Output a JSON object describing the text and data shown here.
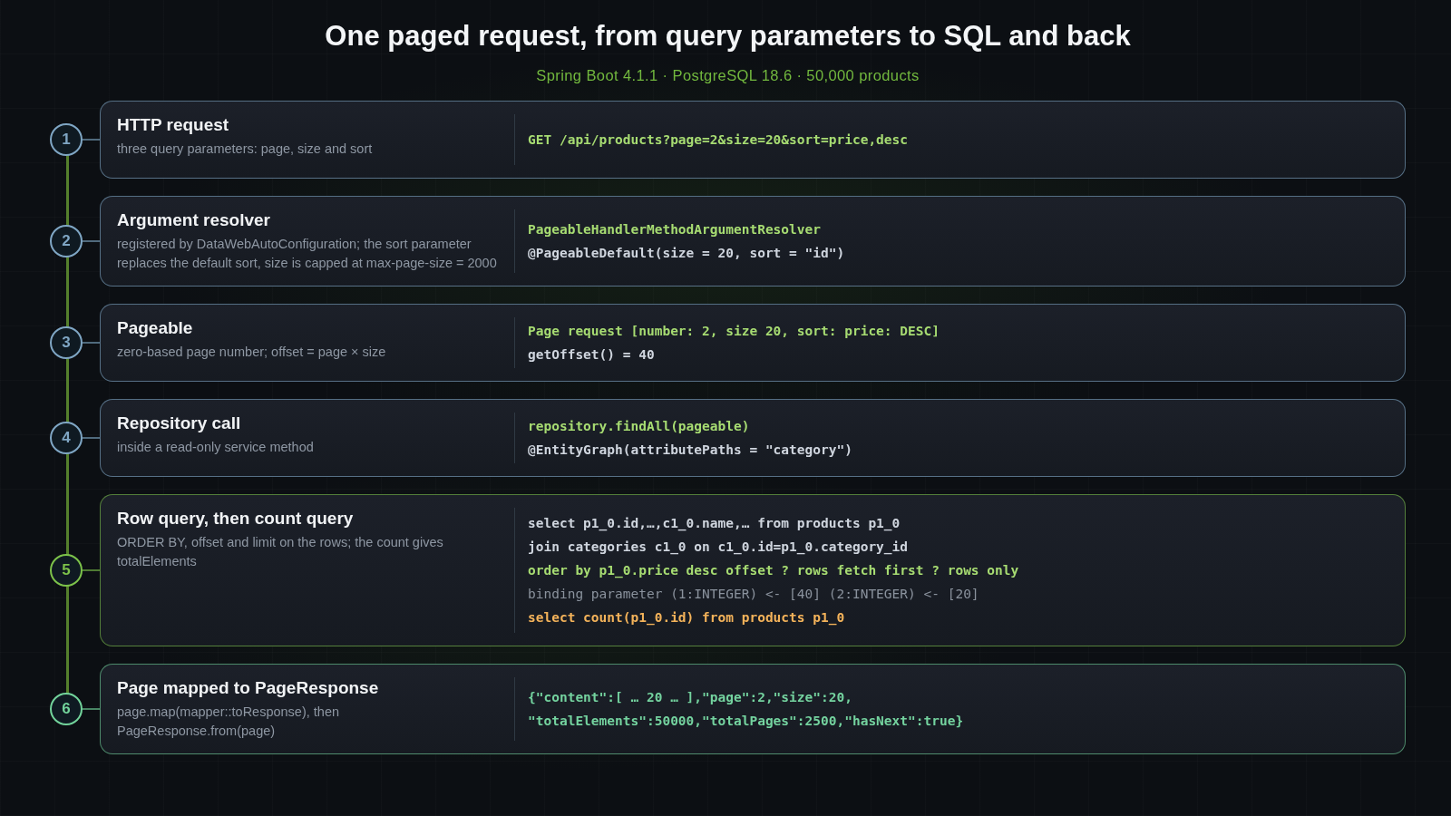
{
  "title": "One paged request, from query parameters to SQL and back",
  "subtitle": "Spring Boot 4.1.1 · PostgreSQL 18.6 · 50,000 products",
  "steps": [
    {
      "number": "1",
      "color": "#7fa6c4",
      "title": "HTTP request",
      "description": "three query parameters: page, size and sort",
      "code": [
        {
          "kind": "key",
          "text": "GET /api/products?page=2&size=20&sort=price,desc"
        }
      ]
    },
    {
      "number": "2",
      "color": "#7fa6c4",
      "title": "Argument resolver",
      "description": "registered by DataWebAutoConfiguration; the sort parameter replaces the default sort, size is capped at max-page-size = 2000",
      "code": [
        {
          "kind": "key",
          "text": "PageableHandlerMethodArgumentResolver"
        },
        {
          "kind": "plain",
          "text": "@PageableDefault(size = 20, sort = \"id\")"
        }
      ]
    },
    {
      "number": "3",
      "color": "#7fa6c4",
      "title": "Pageable",
      "description": "zero-based page number; offset = page × size",
      "code": [
        {
          "kind": "key",
          "text": "Page request [number: 2, size 20, sort: price: DESC]"
        },
        {
          "kind": "plain",
          "text": "getOffset() = 40"
        }
      ]
    },
    {
      "number": "4",
      "color": "#7fa6c4",
      "title": "Repository call",
      "description": "inside a read-only service method",
      "code": [
        {
          "kind": "key",
          "text": "repository.findAll(pageable)"
        },
        {
          "kind": "plain",
          "text": "@EntityGraph(attributePaths = \"category\")"
        }
      ]
    },
    {
      "number": "5",
      "color": "#7cc24a",
      "title": "Row query, then count query",
      "description": "ORDER BY, offset and limit on the rows; the count gives totalElements",
      "code": [
        {
          "kind": "plain",
          "text": "select p1_0.id,…,c1_0.name,… from products p1_0"
        },
        {
          "kind": "plain",
          "text": "join categories c1_0 on c1_0.id=p1_0.category_id"
        },
        {
          "kind": "key",
          "text": "order by p1_0.price desc offset ? rows fetch first ? rows only"
        },
        {
          "kind": "dim",
          "text": "binding parameter (1:INTEGER) <- [40] (2:INTEGER) <- [20]"
        },
        {
          "kind": "count",
          "text": "select count(p1_0.id) from products p1_0"
        }
      ]
    },
    {
      "number": "6",
      "color": "#72d39b",
      "title": "Page mapped to PageResponse",
      "description": "page.map(mapper::toResponse), then PageResponse.from(page)",
      "code": [
        {
          "kind": "json",
          "text": "{\"content\":[ … 20 … ],\"page\":2,\"size\":20,"
        },
        {
          "kind": "json",
          "text": "\"totalElements\":50000,\"totalPages\":2500,\"hasNext\":true}"
        }
      ]
    }
  ]
}
